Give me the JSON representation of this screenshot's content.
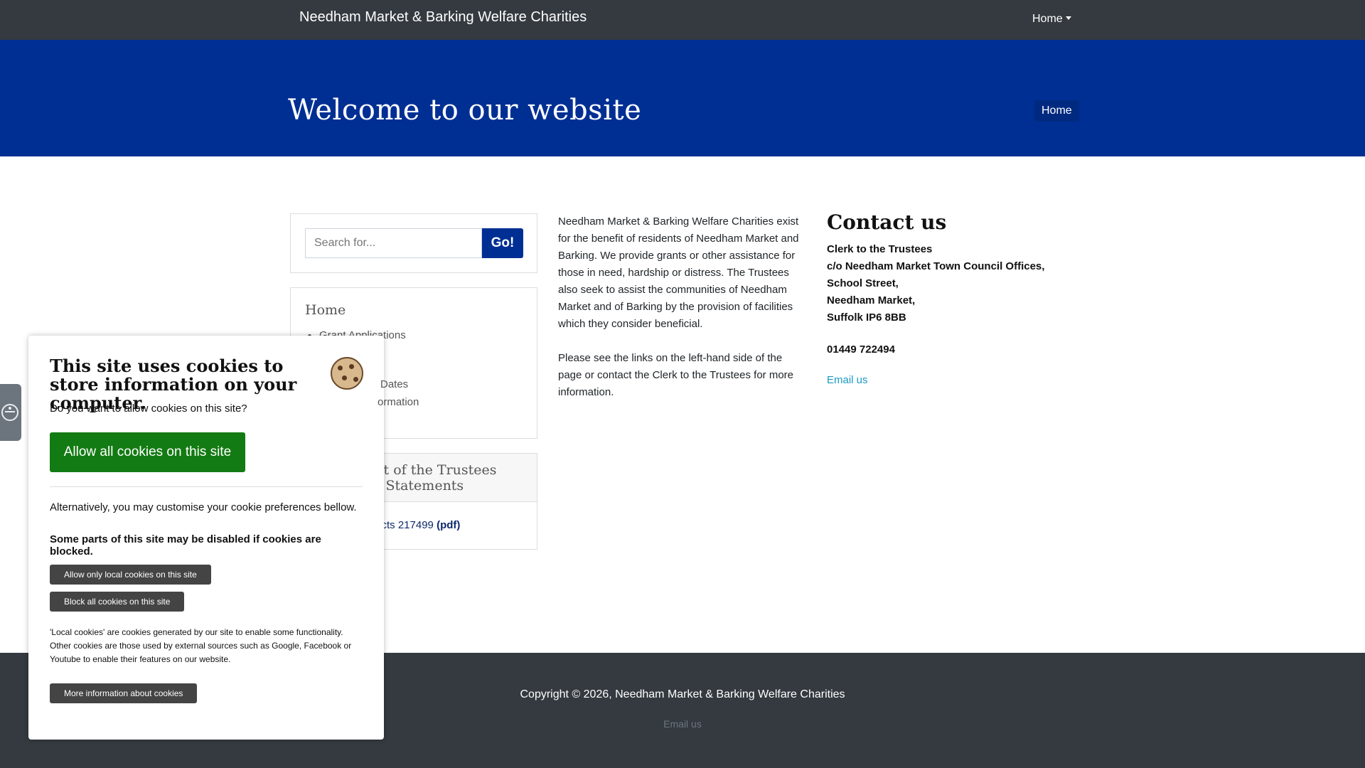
{
  "navbar": {
    "brand": "Needham Market & Barking Welfare Charities",
    "home_label": "Home"
  },
  "hero": {
    "title": "Welcome to our website",
    "breadcrumb": "Home"
  },
  "search": {
    "placeholder": "Search for...",
    "button_label": "Go!"
  },
  "menu": {
    "title": "Home",
    "items": [
      "Grant Applications",
      "",
      "",
      "Dates",
      "ormation"
    ]
  },
  "report": {
    "title_line1": "ort of the Trustees",
    "title_line2": "al Statements",
    "link_text": "Accts 217499",
    "link_suffix": "(pdf)"
  },
  "intro": {
    "paragraph1": "Needham Market & Barking Welfare Charities exist for the benefit of residents of Needham Market and Barking. We provide grants or other assistance for those in need, hardship or distress. The Trustees also seek to assist the communities of Needham Market and of Barking by the provision of facilities which they consider beneficial.",
    "paragraph2": "Please see the links on the left-hand side of the page or contact the Clerk to the Trustees for more information."
  },
  "contact": {
    "title": "Contact us",
    "lines": [
      "Clerk to the Trustees",
      "c/o Needham Market Town Council Offices,",
      "School Street,",
      "Needham Market,",
      "Suffolk IP6 8BB"
    ],
    "phone": "01449 722494",
    "email_label": "Email us"
  },
  "footer": {
    "copyright": "Copyright © 2026, Needham Market & Barking Welfare Charities",
    "email_label": "Email us"
  },
  "cookie": {
    "title": "This site uses cookies to store information on your computer.",
    "question": "Do you want to allow cookies on this site?",
    "allow_all": "Allow all cookies on this site",
    "alternative": "Alternatively, you may customise your cookie preferences bellow.",
    "warning": "Some parts of this site may be disabled if cookies are blocked.",
    "allow_local": "Allow only local cookies on this site",
    "block_all": "Block all cookies on this site",
    "note": "'Local cookies' are cookies generated by our site to enable some functionality. Other cookies are those used by external sources such as Google, Facebook or Youtube to enable their features on our website.",
    "more_info": "More information about cookies"
  },
  "icons": {
    "cookie": "cookie-icon",
    "accessibility": "accessibility-icon",
    "caret": "chevron-down-icon"
  },
  "colors": {
    "navbar": "#343a40",
    "hero": "#002f94",
    "allow_button": "#137b13",
    "link": "#1a9bc2"
  }
}
